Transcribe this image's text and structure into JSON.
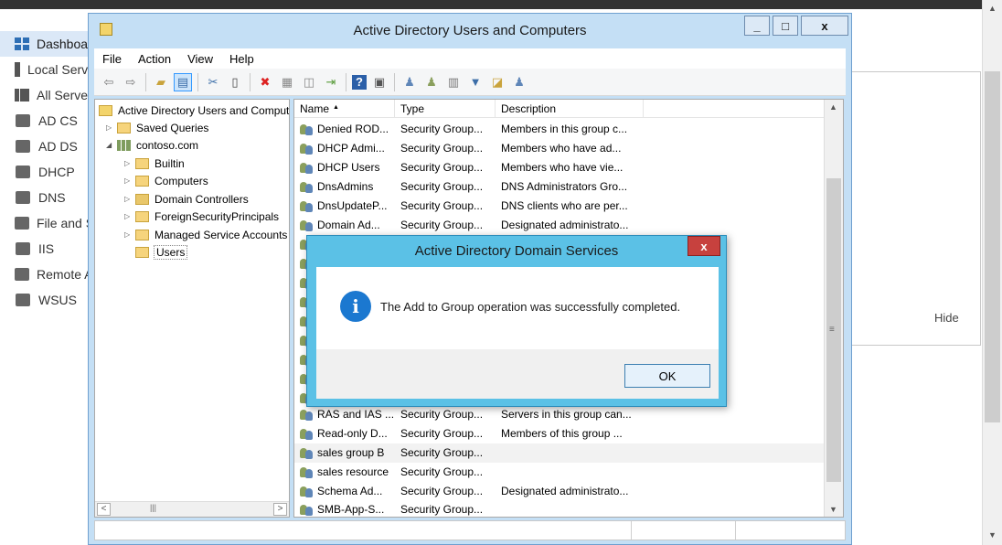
{
  "server_manager": {
    "sidebar": [
      {
        "label": "Dashboard",
        "icon": "dashboard-icon",
        "active": true
      },
      {
        "label": "Local Server",
        "icon": "server-icon"
      },
      {
        "label": "All Servers",
        "icon": "servers-icon"
      },
      {
        "label": "AD CS",
        "icon": "certificate-icon"
      },
      {
        "label": "AD DS",
        "icon": "directory-icon"
      },
      {
        "label": "DHCP",
        "icon": "dhcp-icon"
      },
      {
        "label": "DNS",
        "icon": "dns-icon"
      },
      {
        "label": "File and Storage Services",
        "icon": "file-storage-icon"
      },
      {
        "label": "IIS",
        "icon": "iis-icon"
      },
      {
        "label": "Remote Access",
        "icon": "remote-icon"
      },
      {
        "label": "WSUS",
        "icon": "wsus-icon"
      }
    ],
    "hide_label": "Hide"
  },
  "window": {
    "title": "Active Directory Users and Computers",
    "controls": {
      "minimize": "_",
      "maximize": "□",
      "close": "x"
    },
    "menu": [
      "File",
      "Action",
      "View",
      "Help"
    ]
  },
  "tree": {
    "root": "Active Directory Users and Computers",
    "items": [
      {
        "label": "Saved Queries",
        "expander": "▷"
      },
      {
        "label": "contoso.com",
        "expander": "◢"
      },
      {
        "label": "Builtin",
        "expander": "▷"
      },
      {
        "label": "Computers",
        "expander": "▷"
      },
      {
        "label": "Domain Controllers",
        "expander": "▷"
      },
      {
        "label": "ForeignSecurityPrincipals",
        "expander": "▷"
      },
      {
        "label": "Managed Service Accounts",
        "expander": "▷"
      },
      {
        "label": "Users",
        "expander": ""
      }
    ]
  },
  "list": {
    "columns": [
      "Name",
      "Type",
      "Description"
    ],
    "rows": [
      {
        "name": "Denied ROD...",
        "type": "Security Group...",
        "description": "Members in this group c..."
      },
      {
        "name": "DHCP Admi...",
        "type": "Security Group...",
        "description": "Members who have ad..."
      },
      {
        "name": "DHCP Users",
        "type": "Security Group...",
        "description": "Members who have vie..."
      },
      {
        "name": "DnsAdmins",
        "type": "Security Group...",
        "description": "DNS Administrators Gro..."
      },
      {
        "name": "DnsUpdateP...",
        "type": "Security Group...",
        "description": "DNS clients who are per..."
      },
      {
        "name": "Domain Ad...",
        "type": "Security Group...",
        "description": "Designated administrato..."
      },
      {
        "name": "RAS and IAS ...",
        "type": "Security Group...",
        "description": "Servers in this group can..."
      },
      {
        "name": "Read-only D...",
        "type": "Security Group...",
        "description": "Members of this group ..."
      },
      {
        "name": "sales group B",
        "type": "Security Group...",
        "description": ""
      },
      {
        "name": "sales resource",
        "type": "Security Group...",
        "description": ""
      },
      {
        "name": "Schema Ad...",
        "type": "Security Group...",
        "description": "Designated administrato..."
      },
      {
        "name": "SMB-App-S...",
        "type": "Security Group...",
        "description": ""
      }
    ]
  },
  "dialog": {
    "title": "Active Directory Domain Services",
    "close_label": "x",
    "message": "The Add to Group operation was successfully completed.",
    "ok_label": "OK",
    "icon": "information-icon"
  },
  "colors": {
    "window_frame": "#c4dff5",
    "dialog_frame": "#5bc1e6",
    "dialog_close": "#c7413e"
  }
}
